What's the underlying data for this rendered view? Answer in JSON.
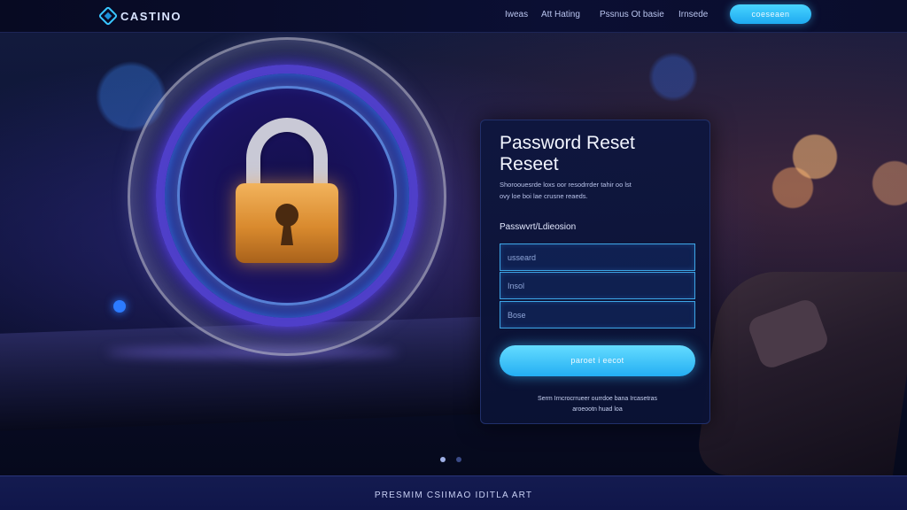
{
  "header": {
    "logo_text": "CASTINO",
    "nav": [
      "Iweas",
      "Att Hating",
      "Pssnus Ot basie",
      "Irnsede"
    ],
    "cta_label": "coeseaen"
  },
  "hero": {
    "illustration": "padlock-orb"
  },
  "reset_card": {
    "title_line1": "Password Reset",
    "title_line2": "Reseet",
    "desc_line1": "Shoroouesrde loxs oor resodrrder tahir oo lst",
    "desc_line2": "ovy loe boi lae crusne reaeds.",
    "field_label": "Passwvrt/Ldieosion",
    "fields": [
      {
        "placeholder": "usseard"
      },
      {
        "placeholder": "Insol"
      },
      {
        "placeholder": "Bose"
      }
    ],
    "submit_label": "paroet i eecot",
    "footer_line1": "Serm Irncrocrrueer ourrdoe bana Ircasetras",
    "footer_line2": "aroeootn huad loa"
  },
  "pagination": {
    "active": 1,
    "count": 2,
    "active_color": "#9fb0e6",
    "inactive_color": "#3a4a86"
  },
  "footer": {
    "text": "PRESMIM CSIIMAO IDITLA ART"
  },
  "colors": {
    "accent": "#2fb8f5",
    "card_bg": "#0e163e",
    "lock_gold": "#e09a3e"
  }
}
